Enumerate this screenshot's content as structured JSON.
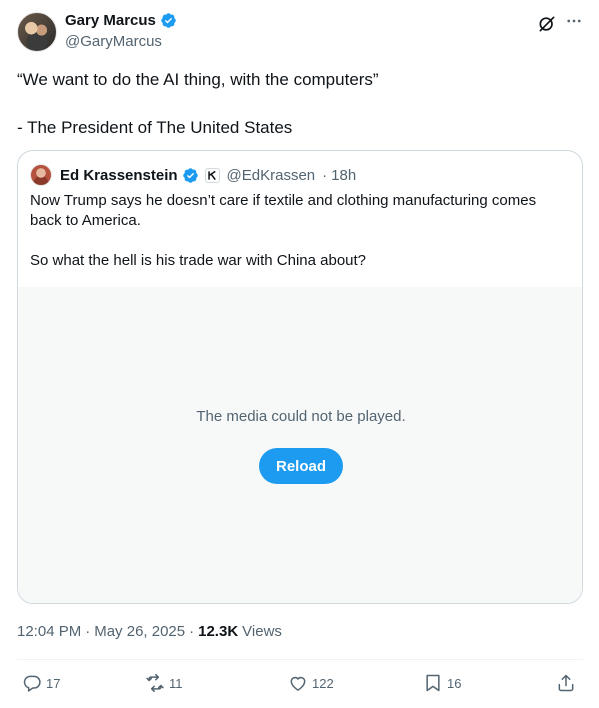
{
  "author": {
    "name": "Gary Marcus",
    "handle": "@GaryMarcus"
  },
  "tweet": {
    "text": "“We want to do the AI thing, with the computers”\n\n- The President of The United States"
  },
  "quoted": {
    "name": "Ed Krassenstein",
    "handle": "@EdKrassen",
    "separator": "·",
    "time": "18h",
    "text": "Now Trump says he doesn’t care if textile and clothing manufacturing comes back to America.\n\nSo what the hell is his trade war with China about?",
    "media": {
      "message": "The media could not be played.",
      "reload_label": "Reload"
    }
  },
  "meta": {
    "time": "12:04 PM",
    "sep1": "·",
    "date": "May 26, 2025",
    "sep2": "·",
    "views": "12.3K",
    "views_label": "Views"
  },
  "actions": {
    "replies": "17",
    "retweets": "11",
    "likes": "122",
    "bookmarks": "16"
  },
  "colors": {
    "accent": "#1d9bf0",
    "secondary_text": "#536471",
    "border": "#cfd9de"
  },
  "icons": [
    "verified-badge-icon",
    "grok-icon",
    "more-icon",
    "affiliate-badge-icon",
    "reply-icon",
    "retweet-icon",
    "like-icon",
    "bookmark-icon",
    "share-icon"
  ]
}
